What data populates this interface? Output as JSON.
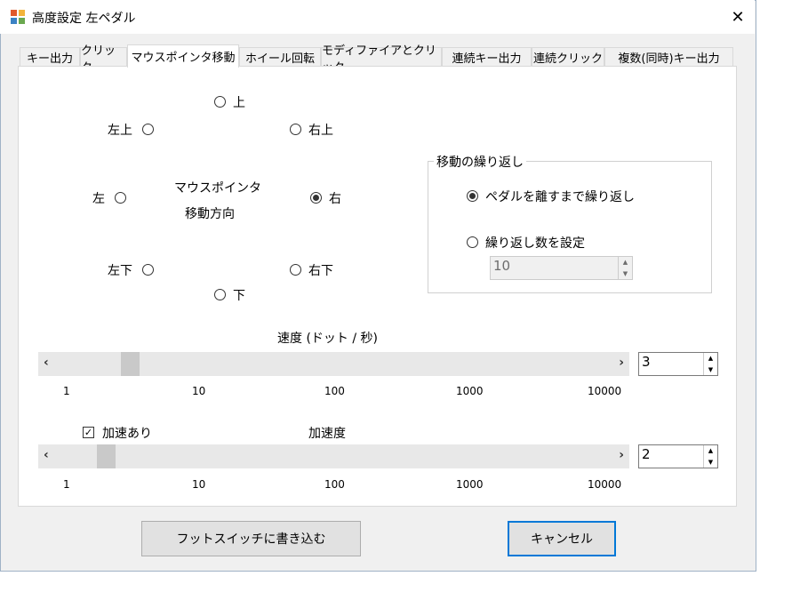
{
  "window": {
    "title": "高度設定 左ペダル"
  },
  "tabs": [
    {
      "label": "キー出力"
    },
    {
      "label": "クリック"
    },
    {
      "label": "マウスポインタ移動"
    },
    {
      "label": "ホイール回転"
    },
    {
      "label": "モディファイアとクリック"
    },
    {
      "label": "連続キー出力"
    },
    {
      "label": "連続クリック"
    },
    {
      "label": "複数(同時)キー出力"
    }
  ],
  "direction": {
    "title_line1": "マウスポインタ",
    "title_line2": "移動方向",
    "up": "上",
    "upper_left": "左上",
    "upper_right": "右上",
    "left": "左",
    "right": "右",
    "lower_left": "左下",
    "lower_right": "右下",
    "down": "下",
    "selected": "右"
  },
  "repeat_group": {
    "title": "移動の繰り返し",
    "option_until_release": "ペダルを離すまで繰り返し",
    "option_set_count": "繰り返し数を設定",
    "count_value": "10",
    "selected": "ペダルを離すまで繰り返し"
  },
  "speed": {
    "label": "速度 (ドット / 秒)",
    "value": "3",
    "ticks": [
      "1",
      "10",
      "100",
      "1000",
      "10000"
    ]
  },
  "acceleration": {
    "checkbox_label": "加速あり",
    "checked": true,
    "label": "加速度",
    "value": "2",
    "ticks": [
      "1",
      "10",
      "100",
      "1000",
      "10000"
    ]
  },
  "buttons": {
    "write": "フットスイッチに書き込む",
    "cancel": "キャンセル"
  },
  "colors": {
    "accent": "#0078d7",
    "window_border": "#9fb2c6"
  }
}
